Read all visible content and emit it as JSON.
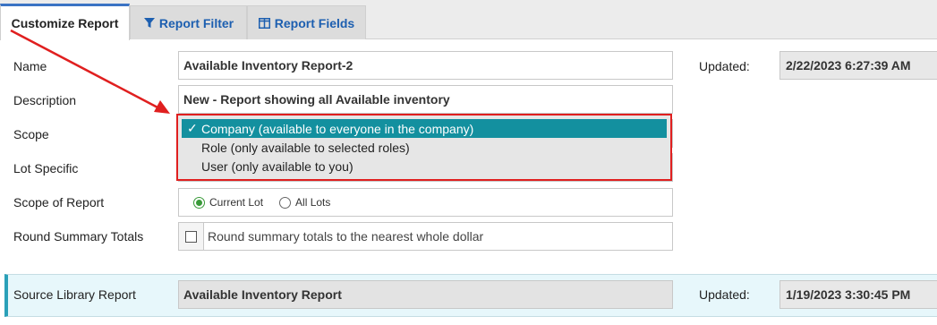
{
  "tabs": [
    {
      "label": "Customize Report",
      "icon": ""
    },
    {
      "label": "Report Filter",
      "icon": "filter-icon"
    },
    {
      "label": "Report Fields",
      "icon": "columns-icon"
    }
  ],
  "form": {
    "name_label": "Name",
    "name_value": "Available Inventory Report-2",
    "description_label": "Description",
    "description_value": "New - Report showing all Available inventory",
    "scope_label": "Scope",
    "lot_specific_label": "Lot Specific",
    "scope_of_report_label": "Scope of Report",
    "scope_options": [
      "Current Lot",
      "All Lots"
    ],
    "scope_selected": "Current Lot",
    "round_label": "Round Summary Totals",
    "round_checkbox_label": "Round summary totals to the nearest whole dollar",
    "updated_label": "Updated:",
    "updated_value": "2/22/2023 6:27:39 AM"
  },
  "scope_dropdown": {
    "check_mark": "✓",
    "options": [
      "Company (available to everyone in the company)",
      "Role (only available to selected roles)",
      "User (only available to you)"
    ],
    "selected_index": 0
  },
  "source": {
    "label": "Source Library Report",
    "value": "Available Inventory Report",
    "updated_label": "Updated:",
    "updated_value": "1/19/2023 3:30:45 PM"
  },
  "colors": {
    "highlight": "#e01f1f",
    "selected_option": "#13909f",
    "tab_link": "#1d5fb0"
  }
}
